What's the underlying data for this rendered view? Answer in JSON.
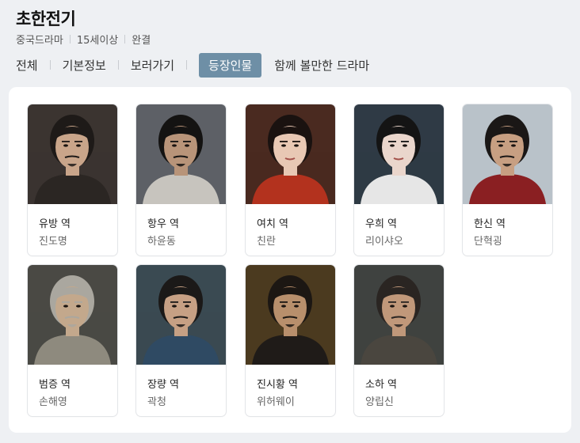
{
  "title": "초한전기",
  "meta": [
    "중국드라마",
    "15세이상",
    "완결"
  ],
  "tabs": [
    {
      "label": "전체"
    },
    {
      "label": "기본정보"
    },
    {
      "label": "보러가기"
    },
    {
      "label": "등장인물",
      "active": true
    },
    {
      "label": "함께 볼만한 드라마"
    }
  ],
  "cast": [
    {
      "role": "유방 역",
      "actor": "진도명",
      "bg": "#3b3430",
      "skin": "#c9a58a",
      "hair": "#1e1a18",
      "robe": "#2b2623",
      "beard": true
    },
    {
      "role": "항우 역",
      "actor": "하윤동",
      "bg": "#5d6066",
      "skin": "#b89479",
      "hair": "#141312",
      "robe": "#c7c4be",
      "beard": true
    },
    {
      "role": "여치 역",
      "actor": "친란",
      "bg": "#4a2a20",
      "skin": "#e8c8b4",
      "hair": "#1a1210",
      "robe": "#b3321e",
      "beard": false
    },
    {
      "role": "우희 역",
      "actor": "리이샤오",
      "bg": "#2f3a45",
      "skin": "#ead6cc",
      "hair": "#141414",
      "robe": "#e6e6e6",
      "beard": false
    },
    {
      "role": "한신 역",
      "actor": "단혁굉",
      "bg": "#b9c2c9",
      "skin": "#c79f82",
      "hair": "#1a1716",
      "robe": "#8a1f22",
      "beard": true
    },
    {
      "role": "범증 역",
      "actor": "손해영",
      "bg": "#4a4944",
      "skin": "#c3a88c",
      "hair": "#aaa79f",
      "robe": "#8e8a7e",
      "beard": true
    },
    {
      "role": "장량 역",
      "actor": "곽청",
      "bg": "#3a4a52",
      "skin": "#c6a084",
      "hair": "#1b1918",
      "robe": "#2f4a63",
      "beard": true
    },
    {
      "role": "진시황 역",
      "actor": "위허웨이",
      "bg": "#4b3a1f",
      "skin": "#b88f6c",
      "hair": "#1c1713",
      "robe": "#1f1b18",
      "beard": true
    },
    {
      "role": "소하 역",
      "actor": "양립신",
      "bg": "#3f4240",
      "skin": "#c0987a",
      "hair": "#2a2522",
      "robe": "#4a463f",
      "beard": true
    }
  ]
}
